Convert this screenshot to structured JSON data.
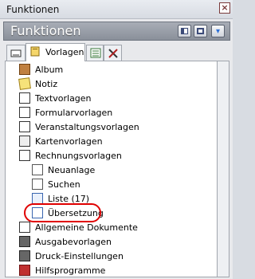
{
  "window": {
    "title": "Funktionen",
    "close_glyph": "×"
  },
  "header": {
    "title": "Funktionen"
  },
  "tabs": [
    {
      "label": "",
      "icon": "blank-page-icon"
    },
    {
      "label": "Vorlagen",
      "icon": "template-icon"
    },
    {
      "label": "",
      "icon": "list-icon"
    },
    {
      "label": "",
      "icon": "tools-icon"
    }
  ],
  "tree": {
    "items": [
      {
        "label": "Album",
        "icon": "album-icon",
        "level": 0
      },
      {
        "label": "Notiz",
        "icon": "note-icon",
        "level": 0
      },
      {
        "label": "Textvorlagen",
        "icon": "text-template-icon",
        "level": 0
      },
      {
        "label": "Formularvorlagen",
        "icon": "form-template-icon",
        "level": 0
      },
      {
        "label": "Veranstaltungsvorlagen",
        "icon": "event-template-icon",
        "level": 0
      },
      {
        "label": "Kartenvorlagen",
        "icon": "card-template-icon",
        "level": 0
      },
      {
        "label": "Rechnungsvorlagen",
        "icon": "invoice-template-icon",
        "level": 0
      },
      {
        "label": "Neuanlage",
        "icon": "new-document-icon",
        "level": 1
      },
      {
        "label": "Suchen",
        "icon": "search-icon",
        "level": 1
      },
      {
        "label": "Liste (17)",
        "icon": "list-icon",
        "level": 1
      },
      {
        "label": "Übersetzung",
        "icon": "translation-icon",
        "level": 1
      },
      {
        "label": "Allgemeine Dokumente",
        "icon": "documents-icon",
        "level": 0
      },
      {
        "label": "Ausgabevorlagen",
        "icon": "printer-icon",
        "level": 0
      },
      {
        "label": "Druck-Einstellungen",
        "icon": "printer-icon",
        "level": 0
      },
      {
        "label": "Hilfsprogramme",
        "icon": "toolbox-icon",
        "level": 0
      }
    ]
  },
  "colors": {
    "highlight": "#e00000"
  }
}
